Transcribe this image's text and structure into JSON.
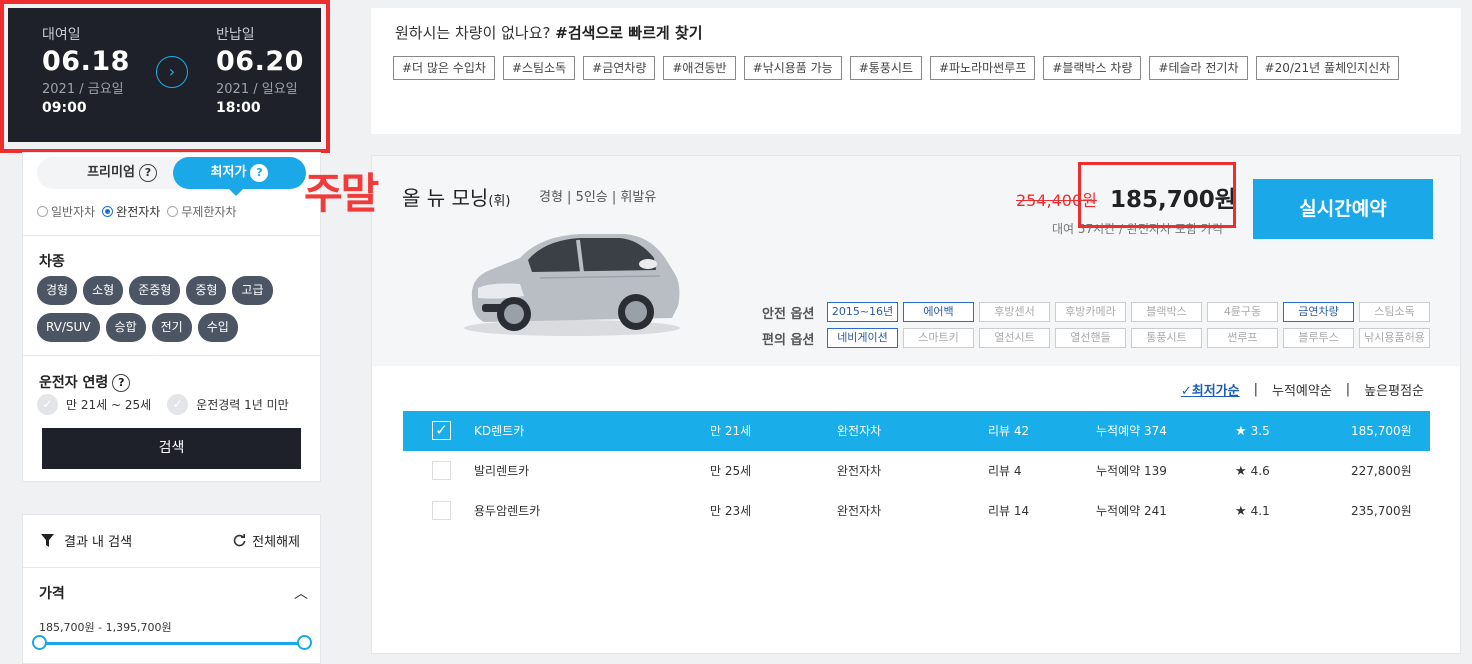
{
  "rental": {
    "start_label": "대여일",
    "start_date": "06.18",
    "start_sub": "2021 / 금요일",
    "start_time": "09:00",
    "end_label": "반납일",
    "end_date": "06.20",
    "end_sub": "2021 / 일요일",
    "end_time": "18:00"
  },
  "price_tabs": {
    "premium": "프리미엄",
    "lowest": "최저가",
    "help": "?"
  },
  "insurance": [
    "일반자차",
    "완전자차",
    "무제한자차"
  ],
  "insurance_selected": "완전자차",
  "car_type": {
    "title": "차종",
    "chips": [
      "경형",
      "소형",
      "준중형",
      "중형",
      "고급",
      "RV/SUV",
      "승합",
      "전기",
      "수입"
    ]
  },
  "driver_age": {
    "title": "운전자 연령",
    "help": "?",
    "options": [
      "만 21세 ~ 25세",
      "운전경력 1년 미만"
    ]
  },
  "search_button": "검색",
  "result_filter": {
    "title": "결과 내 검색",
    "reset": "전체해제",
    "price_title": "가격",
    "price_range": "185,700원 - 1,395,700원"
  },
  "tags": {
    "heading_plain": "원하시는 차량이 없나요? ",
    "heading_bold": "#검색으로 빠르게 찾기",
    "items": [
      "#더 많은 수입차",
      "#스팀소독",
      "#금연차량",
      "#애견동반",
      "#낚시용품 가능",
      "#통풍시트",
      "#파노라마썬루프",
      "#블랙박스 차량",
      "#테슬라 전기차",
      "#20/21년 풀체인지신차"
    ]
  },
  "car": {
    "annotation": "주말",
    "name": "올 뉴 모닝",
    "name_suffix": "(휘)",
    "spec": "경형 | 5인승 | 휘발유",
    "old_price": "254,400원",
    "price": "185,700원",
    "price_note": "대여 57시간 / 완전자차 포함 가격",
    "reserve": "실시간예약",
    "safety_label": "안전 옵션",
    "safety": [
      {
        "label": "2015~16년",
        "on": true
      },
      {
        "label": "에어백",
        "on": true
      },
      {
        "label": "후방센서",
        "on": false
      },
      {
        "label": "후방카메라",
        "on": false
      },
      {
        "label": "블랙박스",
        "on": false
      },
      {
        "label": "4륜구동",
        "on": false
      },
      {
        "label": "금연차량",
        "on": true
      },
      {
        "label": "스팀소독",
        "on": false
      }
    ],
    "convenience_label": "편의 옵션",
    "convenience": [
      {
        "label": "네비게이션",
        "on": true
      },
      {
        "label": "스마트키",
        "on": false
      },
      {
        "label": "열선시트",
        "on": false
      },
      {
        "label": "열선핸들",
        "on": false
      },
      {
        "label": "통풍시트",
        "on": false
      },
      {
        "label": "썬루프",
        "on": false
      },
      {
        "label": "블루투스",
        "on": false
      },
      {
        "label": "낚시용품허용",
        "on": false
      }
    ]
  },
  "sort": {
    "options": [
      "최저가순",
      "누적예약순",
      "높은평점순"
    ],
    "active": "최저가순",
    "check": "✓",
    "sep": "|"
  },
  "companies": [
    {
      "name": "KD렌트카",
      "age": "만 21세",
      "insurance": "완전자차",
      "reviews": "리뷰 42",
      "bookings": "누적예약 374",
      "rating": "3.5",
      "price": "185,700원",
      "selected": true
    },
    {
      "name": "발리렌트카",
      "age": "만 25세",
      "insurance": "완전자차",
      "reviews": "리뷰 4",
      "bookings": "누적예약 139",
      "rating": "4.6",
      "price": "227,800원",
      "selected": false
    },
    {
      "name": "용두암렌트카",
      "age": "만 23세",
      "insurance": "완전자차",
      "reviews": "리뷰 14",
      "bookings": "누적예약 241",
      "rating": "4.1",
      "price": "235,700원",
      "selected": false
    }
  ],
  "colors": {
    "accent": "#1aa8e8",
    "highlight": "#ee2e2e",
    "dark": "#1e2129"
  }
}
